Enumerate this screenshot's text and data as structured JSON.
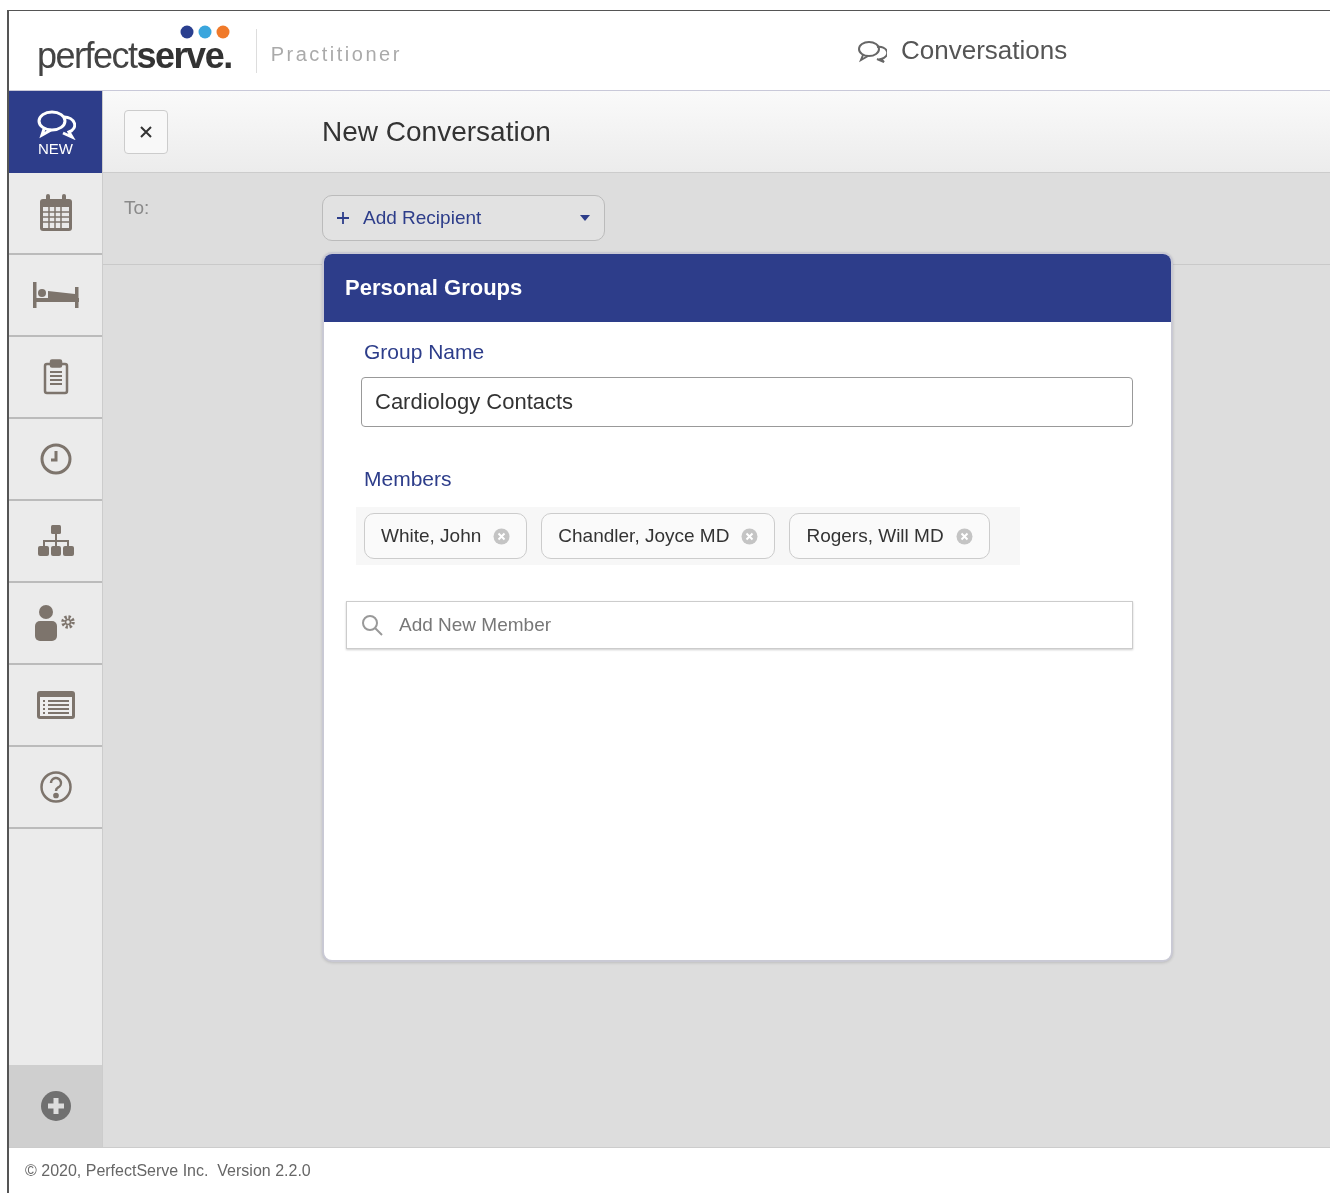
{
  "header": {
    "logo": "perfect**serve.**",
    "product": "Practitioner",
    "section": "Conversations"
  },
  "sidebar": {
    "items": [
      {
        "kind": "chat",
        "label": "NEW",
        "selected": true
      },
      {
        "kind": "calendar",
        "selected": false
      },
      {
        "kind": "bed",
        "selected": false
      },
      {
        "kind": "clipboard",
        "selected": false
      },
      {
        "kind": "clock",
        "selected": false
      },
      {
        "kind": "hierarchy",
        "selected": false
      },
      {
        "kind": "user-gear",
        "selected": false
      },
      {
        "kind": "list",
        "selected": false
      },
      {
        "kind": "help",
        "selected": false
      }
    ]
  },
  "conversation": {
    "title": "New Conversation",
    "to_label": "To:",
    "add_recipient": "Add Recipient"
  },
  "group_panel": {
    "title": "Personal Groups",
    "name_label": "Group Name",
    "name_value": "Cardiology Contacts",
    "members_label": "Members",
    "members": [
      "White, John",
      "Chandler, Joyce MD",
      "Rogers, Will MD"
    ],
    "search_placeholder": "Add New Member"
  },
  "footer": "© 2020, PerfectServe Inc.  Version 2.2.0"
}
